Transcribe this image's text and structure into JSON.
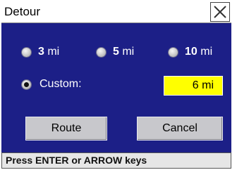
{
  "window": {
    "title": "Detour"
  },
  "distance_options": [
    {
      "value": "3",
      "unit": " mi",
      "selected": false
    },
    {
      "value": "5",
      "unit": " mi",
      "selected": false
    },
    {
      "value": "10",
      "unit": " mi",
      "selected": false
    }
  ],
  "custom": {
    "label": "Custom:",
    "selected": true,
    "value": "6 mi"
  },
  "buttons": {
    "route": "Route",
    "cancel": "Cancel"
  },
  "status": {
    "text": "Press ENTER or ARROW keys"
  },
  "colors": {
    "panel_background": "#1c1f87",
    "custom_field_background": "#ffff00"
  }
}
